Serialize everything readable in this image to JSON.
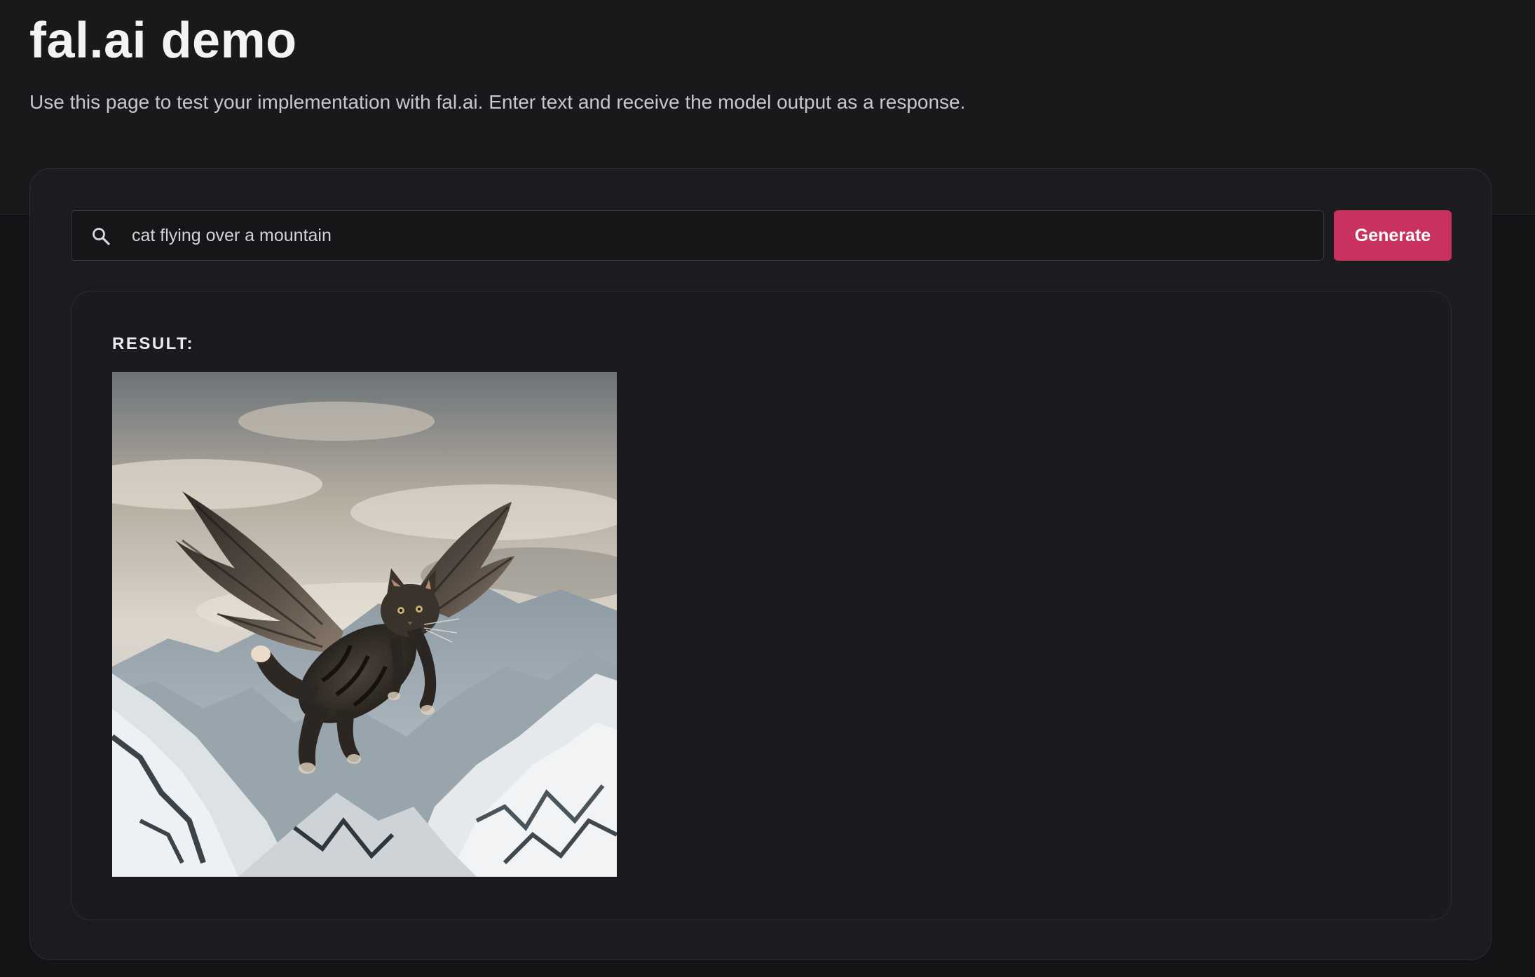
{
  "page": {
    "title": "fal.ai demo",
    "subtitle": "Use this page to test your implementation with fal.ai. Enter text and receive the model output as a response."
  },
  "search": {
    "icon": "search-icon",
    "value": "cat flying over a mountain"
  },
  "generate_button": {
    "label": "Generate",
    "color": "#c9325e"
  },
  "result": {
    "label": "RESULT:",
    "image_subject": "winged-cat-over-mountains"
  },
  "colors": {
    "background": "#141417",
    "card": "#1c1c20",
    "accent": "#c9325e"
  }
}
